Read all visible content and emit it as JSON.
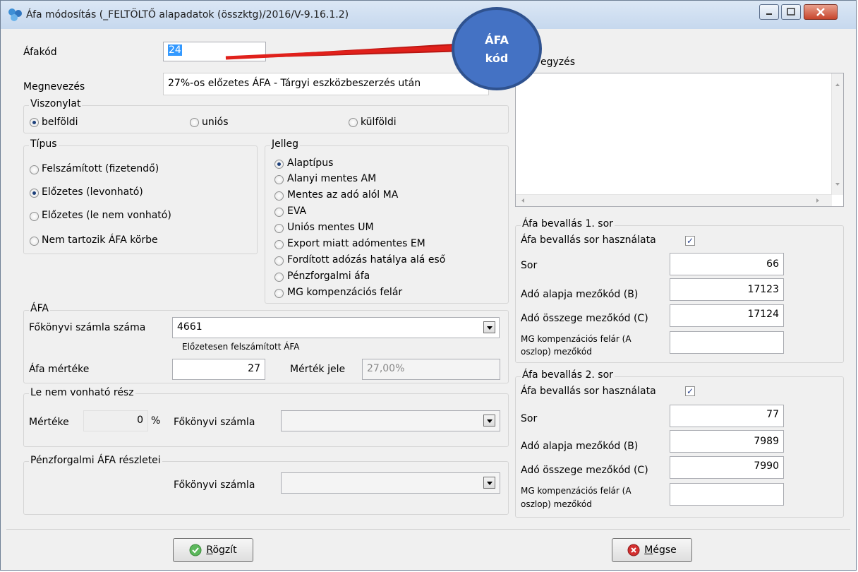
{
  "window": {
    "title": "Áfa módosítás (_FELTÖLTŐ alapadatok (összktg)/2016/V-9.16.1.2)"
  },
  "afakod": {
    "label": "Áfakód",
    "value": "24"
  },
  "megnevezes": {
    "label": "Megnevezés",
    "value": "27%-os előzetes ÁFA - Tárgyi eszközbeszerzés után"
  },
  "callout": {
    "line1": "ÁFA",
    "line2": "kód"
  },
  "viszonylat": {
    "legend": "Viszonylat",
    "options": [
      "belföldi",
      "uniós",
      "külföldi"
    ],
    "selected": "belföldi"
  },
  "tipus": {
    "legend": "Típus",
    "options": [
      "Felszámított (fizetendő)",
      "Előzetes (levonható)",
      "Előzetes (le nem vonható)",
      "Nem tartozik ÁFA körbe"
    ],
    "selected": "Előzetes (levonható)"
  },
  "jelleg": {
    "legend": "Jelleg",
    "options": [
      "Alaptípus",
      "Alanyi mentes AM",
      "Mentes az adó alól  MA",
      "EVA",
      "Uniós mentes UM",
      "Export miatt adómentes EM",
      "Fordított adózás hatálya alá eső",
      "Pénzforgalmi áfa",
      "MG kompenzációs felár"
    ],
    "selected": "Alaptípus"
  },
  "afa": {
    "legend": "ÁFA",
    "fokonyvi_label": "Főkönyvi számla száma",
    "fokonyvi_value": "4661",
    "fokonyvi_desc": "Előzetesen felszámított ÁFA",
    "mertek_label": "Áfa mértéke",
    "mertek_value": "27",
    "jele_label": "Mérték jele",
    "jele_value": "27,00%"
  },
  "lenem": {
    "legend": "Le nem vonható rész",
    "mertek_label": "Mértéke",
    "mertek_value": "0",
    "percent": "%",
    "fokonyvi_label": "Főkönyvi számla",
    "fokonyvi_value": ""
  },
  "penzforgalmi": {
    "legend": "Pénzforgalmi ÁFA részletei",
    "fokonyvi_label": "Főkönyvi számla",
    "fokonyvi_value": ""
  },
  "megjegyzes": {
    "label": "egyzés",
    "value": ""
  },
  "bevallas1": {
    "legend": "Áfa bevallás 1. sor",
    "hasznalata_label": "Áfa bevallás sor használata",
    "checked": true,
    "sor_label": "Sor",
    "sor_value": "66",
    "alap_label": "Adó alapja mezőkód (B)",
    "alap_value": "17123",
    "osszeg_label": "Adó összege mezőkód (C)",
    "osszeg_value": "17124",
    "mg_label_1": "MG kompenzációs felár (A",
    "mg_label_2": "oszlop) mezőkód",
    "mg_value": ""
  },
  "bevallas2": {
    "legend": "Áfa bevallás 2. sor",
    "hasznalata_label": "Áfa bevallás sor használata",
    "checked": true,
    "sor_label": "Sor",
    "sor_value": "77",
    "alap_label": "Adó alapja mezőkód (B)",
    "alap_value": "7989",
    "osszeg_label": "Adó összege mezőkód (C)",
    "osszeg_value": "7990",
    "mg_label_1": "MG kompenzációs felár (A",
    "mg_label_2": "oszlop) mezőkód",
    "mg_value": ""
  },
  "buttons": {
    "rogzit_first": "R",
    "rogzit_rest": "ögzít",
    "megse_first": "M",
    "megse_rest": "égse"
  },
  "colors": {
    "accent": "#4472c4",
    "arrow": "#e0201b",
    "ok": "#4caf50",
    "cancel": "#c62828"
  }
}
